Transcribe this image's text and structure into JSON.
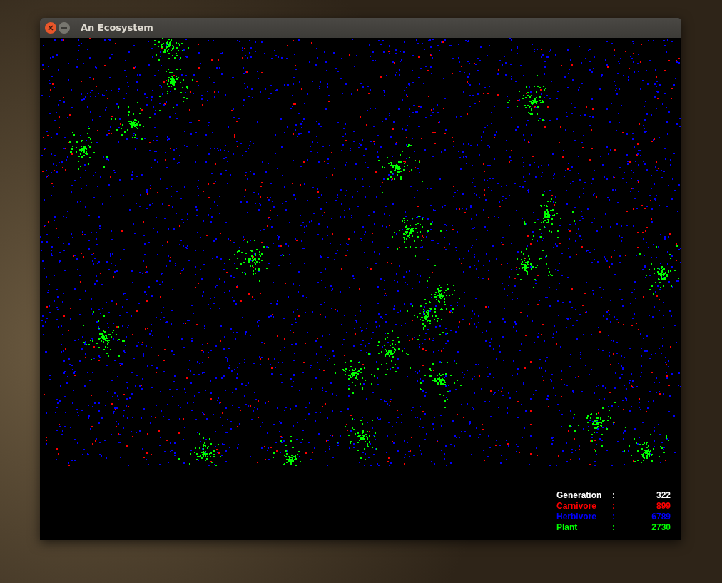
{
  "window": {
    "title": "An Ecosystem"
  },
  "stats": [
    {
      "label": "Generation",
      "separator": ":",
      "value": "322",
      "color": "#ffffff"
    },
    {
      "label": "Carnivore",
      "separator": ":",
      "value": "899",
      "color": "#ff0000"
    },
    {
      "label": "Herbivore",
      "separator": ":",
      "value": "6789",
      "color": "#0000ff"
    },
    {
      "label": "Plant",
      "separator": ":",
      "value": "2730",
      "color": "#00ff00"
    }
  ]
}
